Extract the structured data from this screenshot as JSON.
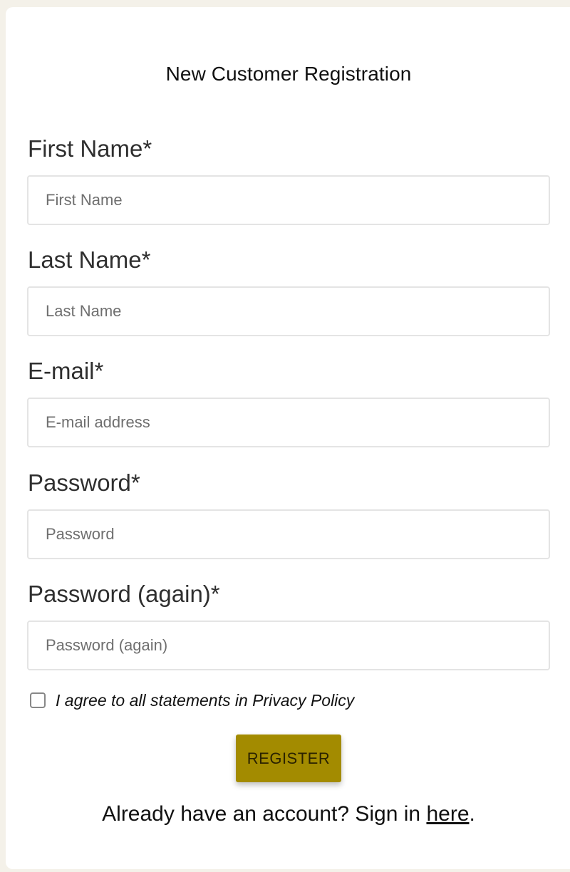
{
  "form": {
    "title": "New Customer Registration",
    "fields": [
      {
        "label": "First Name*",
        "placeholder": "First Name"
      },
      {
        "label": "Last Name*",
        "placeholder": "Last Name"
      },
      {
        "label": "E-mail*",
        "placeholder": "E-mail address"
      },
      {
        "label": "Password*",
        "placeholder": "Password"
      },
      {
        "label": "Password (again)*",
        "placeholder": "Password (again)"
      }
    ],
    "consent": {
      "label": "I agree to all statements in Privacy Policy",
      "checked": false
    },
    "register_label": "REGISTER",
    "signin": {
      "prefix": "Already have an account? Sign in ",
      "link": "here",
      "suffix": "."
    }
  },
  "colors": {
    "page_background": "#f4f1e9",
    "card_background": "#ffffff",
    "button_background": "#a38b00",
    "input_border": "#e4e4e4"
  }
}
